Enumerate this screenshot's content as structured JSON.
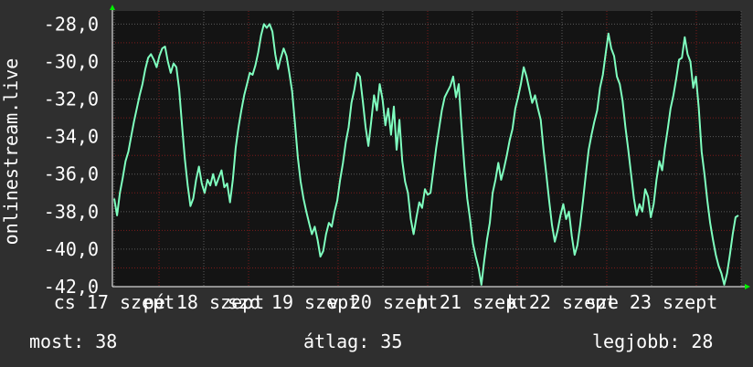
{
  "chart_data": {
    "type": "line",
    "ylabel": "onlinestream.live",
    "ylim": [
      -42,
      -27
    ],
    "y_ticks": [
      "-28,0",
      "-30,0",
      "-32,0",
      "-34,0",
      "-36,0",
      "-38,0",
      "-40,0",
      "-42,0"
    ],
    "x_tick_labels": [
      "cs 17 szept",
      "pé 18 szept",
      "szo 19 szept",
      "v 20 szept",
      "h 21 szept",
      "k 22 szept",
      "sze 23 szept"
    ],
    "grid": true,
    "colors": {
      "background": "#2f2f2f",
      "plot": "#141414",
      "line": "#7fffbf",
      "grid": "#5a5a5a",
      "grid_minor": "#7a1a1a",
      "axis_arrow": "#00ee00"
    },
    "series": [
      {
        "values": [
          -37.3,
          -38.2,
          -37.0,
          -36.2,
          -35.3,
          -34.8,
          -34.0,
          -33.2,
          -32.5,
          -31.8,
          -31.2,
          -30.4,
          -29.8,
          -29.6,
          -29.9,
          -30.3,
          -29.7,
          -29.3,
          -29.2,
          -30.0,
          -30.6,
          -30.1,
          -30.3,
          -31.5,
          -33.4,
          -35.2,
          -36.6,
          -37.7,
          -37.3,
          -36.3,
          -35.6,
          -36.5,
          -37.0,
          -36.3,
          -36.6,
          -36.0,
          -36.6,
          -36.2,
          -35.8,
          -36.7,
          -36.5,
          -37.5,
          -36.3,
          -34.6,
          -33.5,
          -32.6,
          -31.8,
          -31.2,
          -30.6,
          -30.7,
          -30.2,
          -29.5,
          -28.6,
          -28.0,
          -28.2,
          -28.0,
          -28.4,
          -29.6,
          -30.4,
          -29.8,
          -29.3,
          -29.7,
          -30.6,
          -31.6,
          -33.3,
          -35.1,
          -36.4,
          -37.3,
          -38.0,
          -38.6,
          -39.2,
          -38.8,
          -39.5,
          -40.4,
          -40.1,
          -39.2,
          -38.6,
          -38.8,
          -38.0,
          -37.4,
          -36.3,
          -35.4,
          -34.3,
          -33.5,
          -32.2,
          -31.5,
          -30.6,
          -30.8,
          -32.1,
          -33.5,
          -34.5,
          -33.2,
          -31.8,
          -32.6,
          -31.2,
          -32.0,
          -33.4,
          -32.5,
          -33.9,
          -32.4,
          -34.7,
          -33.1,
          -35.3,
          -36.4,
          -37.0,
          -38.4,
          -39.2,
          -38.3,
          -37.5,
          -37.8,
          -36.8,
          -37.1,
          -37.0,
          -35.8,
          -34.6,
          -33.6,
          -32.6,
          -31.9,
          -31.6,
          -31.3,
          -30.8,
          -31.9,
          -31.2,
          -33.5,
          -35.6,
          -37.3,
          -38.4,
          -39.7,
          -40.4,
          -41.0,
          -41.9,
          -40.6,
          -39.5,
          -38.6,
          -37.0,
          -36.3,
          -35.4,
          -36.3,
          -35.7,
          -35.0,
          -34.2,
          -33.6,
          -32.5,
          -31.9,
          -31.2,
          -30.3,
          -30.8,
          -31.5,
          -32.2,
          -31.8,
          -32.5,
          -33.1,
          -34.7,
          -36.0,
          -37.4,
          -38.7,
          -39.6,
          -39.0,
          -38.2,
          -37.6,
          -38.4,
          -38.0,
          -39.3,
          -40.3,
          -39.8,
          -38.7,
          -37.4,
          -36.0,
          -34.7,
          -33.9,
          -33.2,
          -32.6,
          -31.4,
          -30.7,
          -29.6,
          -28.5,
          -29.3,
          -29.7,
          -30.8,
          -31.2,
          -32.1,
          -33.5,
          -34.7,
          -36.0,
          -37.3,
          -38.2,
          -37.6,
          -38.0,
          -36.8,
          -37.2,
          -38.3,
          -37.6,
          -36.3,
          -35.3,
          -35.8,
          -34.6,
          -33.6,
          -32.5,
          -31.8,
          -30.9,
          -29.9,
          -29.8,
          -28.7,
          -29.6,
          -30.0,
          -31.4,
          -30.8,
          -32.5,
          -34.8,
          -36.0,
          -37.4,
          -38.6,
          -39.5,
          -40.3,
          -40.9,
          -41.3,
          -41.9,
          -41.3,
          -40.3,
          -39.2,
          -38.3,
          -38.2
        ]
      }
    ]
  },
  "stats": {
    "current": "most: 38",
    "average": "átlag: 35",
    "best": "legjobb: 28"
  }
}
